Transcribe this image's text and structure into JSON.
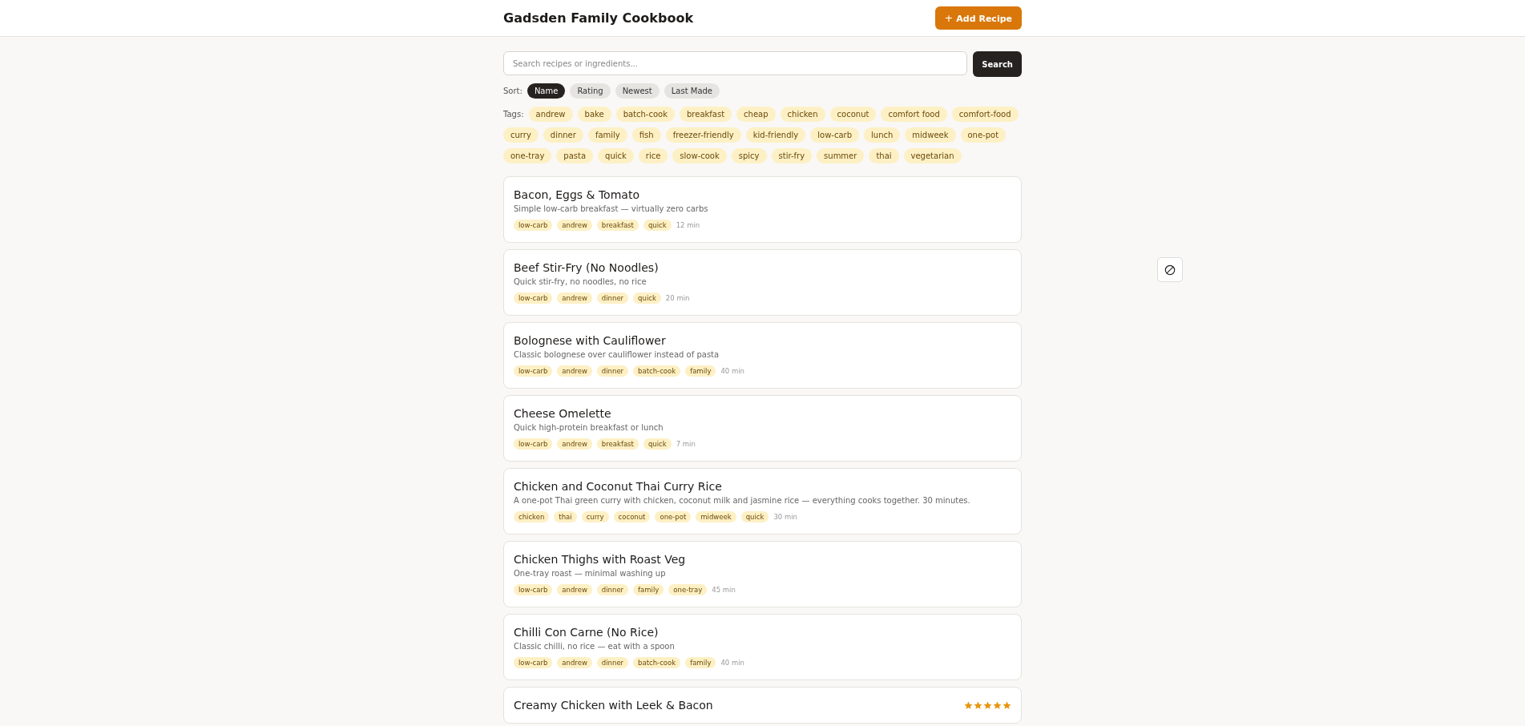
{
  "header": {
    "title": "Gadsden Family Cookbook",
    "add_button": {
      "icon": "+",
      "label": "Add Recipe"
    }
  },
  "search": {
    "placeholder": "Search recipes or ingredients...",
    "button": "Search"
  },
  "sort": {
    "label": "Sort:",
    "options": [
      {
        "label": "Name",
        "selected": true
      },
      {
        "label": "Rating",
        "selected": false
      },
      {
        "label": "Newest",
        "selected": false
      },
      {
        "label": "Last Made",
        "selected": false
      }
    ]
  },
  "tags": {
    "label": "Tags:",
    "items": [
      "andrew",
      "bake",
      "batch-cook",
      "breakfast",
      "cheap",
      "chicken",
      "coconut",
      "comfort food",
      "comfort-food",
      "curry",
      "dinner",
      "family",
      "fish",
      "freezer-friendly",
      "kid-friendly",
      "low-carb",
      "lunch",
      "midweek",
      "one-pot",
      "one-tray",
      "pasta",
      "quick",
      "rice",
      "slow-cook",
      "spicy",
      "stir-fry",
      "summer",
      "thai",
      "vegetarian"
    ]
  },
  "recipes": [
    {
      "title": "Bacon, Eggs & Tomato",
      "description": "Simple low-carb breakfast — virtually zero carbs",
      "tags": [
        "low-carb",
        "andrew",
        "breakfast",
        "quick"
      ],
      "time": "12 min"
    },
    {
      "title": "Beef Stir-Fry (No Noodles)",
      "description": "Quick stir-fry, no noodles, no rice",
      "tags": [
        "low-carb",
        "andrew",
        "dinner",
        "quick"
      ],
      "time": "20 min"
    },
    {
      "title": "Bolognese with Cauliflower",
      "description": "Classic bolognese over cauliflower instead of pasta",
      "tags": [
        "low-carb",
        "andrew",
        "dinner",
        "batch-cook",
        "family"
      ],
      "time": "40 min"
    },
    {
      "title": "Cheese Omelette",
      "description": "Quick high-protein breakfast or lunch",
      "tags": [
        "low-carb",
        "andrew",
        "breakfast",
        "quick"
      ],
      "time": "7 min"
    },
    {
      "title": "Chicken and Coconut Thai Curry Rice",
      "description": "A one-pot Thai green curry with chicken, coconut milk and jasmine rice — everything cooks together. 30 minutes.",
      "tags": [
        "chicken",
        "thai",
        "curry",
        "coconut",
        "one-pot",
        "midweek",
        "quick"
      ],
      "time": "30 min"
    },
    {
      "title": "Chicken Thighs with Roast Veg",
      "description": "One-tray roast — minimal washing up",
      "tags": [
        "low-carb",
        "andrew",
        "dinner",
        "family",
        "one-tray"
      ],
      "time": "45 min"
    },
    {
      "title": "Chilli Con Carne (No Rice)",
      "description": "Classic chilli, no rice — eat with a spoon",
      "tags": [
        "low-carb",
        "andrew",
        "dinner",
        "batch-cook",
        "family"
      ],
      "time": "40 min"
    },
    {
      "title": "Creamy Chicken with Leek & Bacon",
      "stars": 5
    }
  ]
}
